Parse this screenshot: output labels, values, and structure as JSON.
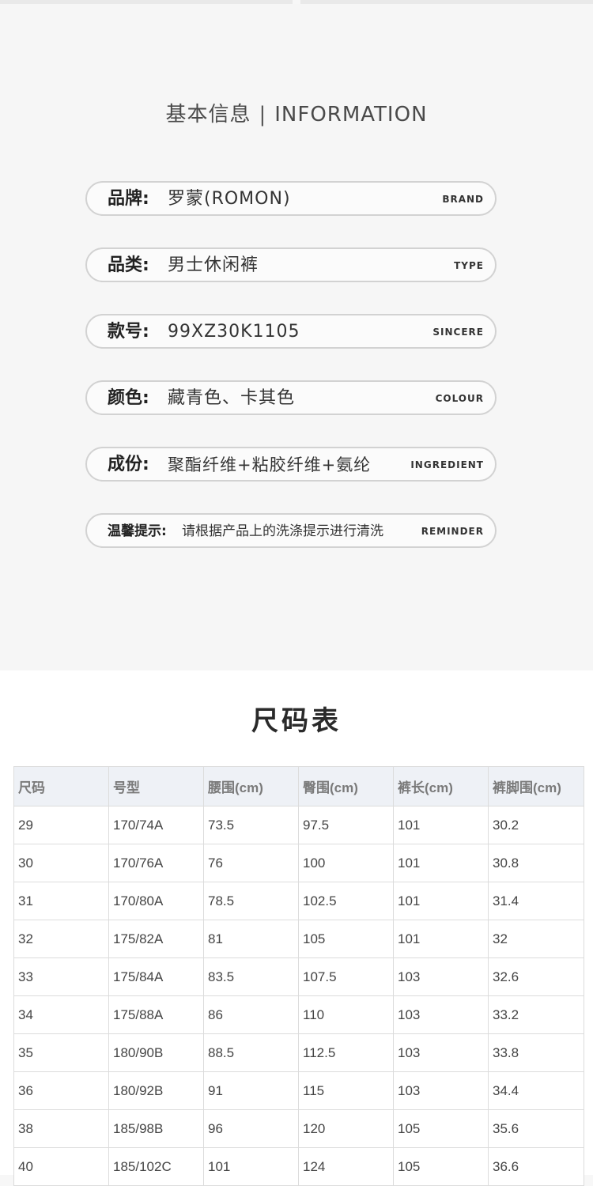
{
  "info": {
    "title_cn": "基本信息",
    "title_sep": "|",
    "title_en": "INFORMATION",
    "rows": [
      {
        "label": "品牌:",
        "value": "罗蒙(ROMON)",
        "tag": "BRAND"
      },
      {
        "label": "品类:",
        "value": "男士休闲裤",
        "tag": "TYPE"
      },
      {
        "label": "款号:",
        "value": "99XZ30K1105",
        "tag": "SINCERE"
      },
      {
        "label": "颜色:",
        "value": "藏青色、卡其色",
        "tag": "COLOUR"
      },
      {
        "label": "成份:",
        "value": "聚酯纤维+粘胶纤维+氨纶",
        "tag": "INGREDIENT"
      },
      {
        "label": "温馨提示:",
        "value": "请根据产品上的洗涤提示进行清洗",
        "tag": "REMINDER"
      }
    ]
  },
  "size_chart": {
    "title": "尺码表",
    "headers": [
      "尺码",
      "号型",
      "腰围(cm)",
      "臀围(cm)",
      "裤长(cm)",
      "裤脚围(cm)"
    ],
    "rows": [
      [
        "29",
        "170/74A",
        "73.5",
        "97.5",
        "101",
        "30.2"
      ],
      [
        "30",
        "170/76A",
        "76",
        "100",
        "101",
        "30.8"
      ],
      [
        "31",
        "170/80A",
        "78.5",
        "102.5",
        "101",
        "31.4"
      ],
      [
        "32",
        "175/82A",
        "81",
        "105",
        "101",
        "32"
      ],
      [
        "33",
        "175/84A",
        "83.5",
        "107.5",
        "103",
        "32.6"
      ],
      [
        "34",
        "175/88A",
        "86",
        "110",
        "103",
        "33.2"
      ],
      [
        "35",
        "180/90B",
        "88.5",
        "112.5",
        "103",
        "33.8"
      ],
      [
        "36",
        "180/92B",
        "91",
        "115",
        "103",
        "34.4"
      ],
      [
        "38",
        "185/98B",
        "96",
        "120",
        "105",
        "35.6"
      ],
      [
        "40",
        "185/102C",
        "101",
        "124",
        "105",
        "36.6"
      ]
    ]
  }
}
